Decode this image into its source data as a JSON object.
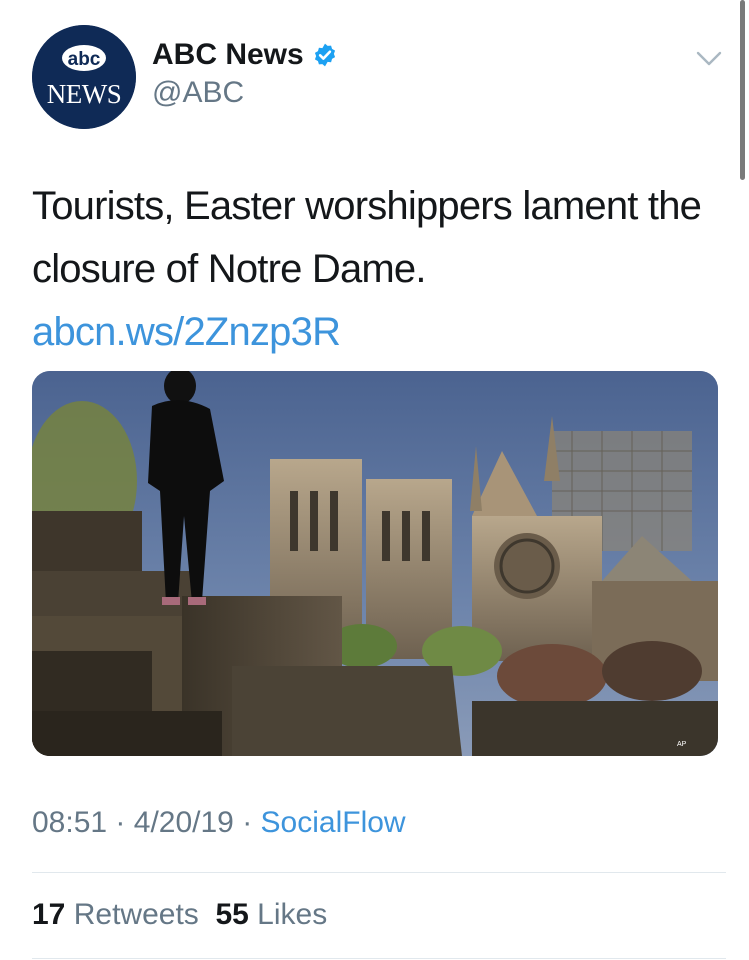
{
  "account": {
    "avatar_logo_top": "abc",
    "avatar_logo_bottom": "NEWS",
    "display_name": "ABC News",
    "handle": "@ABC",
    "verified": true
  },
  "tweet": {
    "text": "Tourists, Easter worshippers lament the closure of Notre Dame.",
    "link_text": "abcn.ws/2Znzp3R",
    "media": {
      "credit": "AP"
    },
    "time": "08:51",
    "date": "4/20/19",
    "separator": "·",
    "source": "SocialFlow"
  },
  "stats": {
    "retweets_count": "17",
    "retweets_label": "Retweets",
    "likes_count": "55",
    "likes_label": "Likes"
  },
  "icons": {
    "caret": "chevron-down-icon",
    "verified": "verified-badge-icon"
  },
  "colors": {
    "link": "#3d94dc",
    "muted": "#657786",
    "text": "#14171a",
    "verified": "#1da1f2",
    "abc_navy": "#0f2a56"
  }
}
